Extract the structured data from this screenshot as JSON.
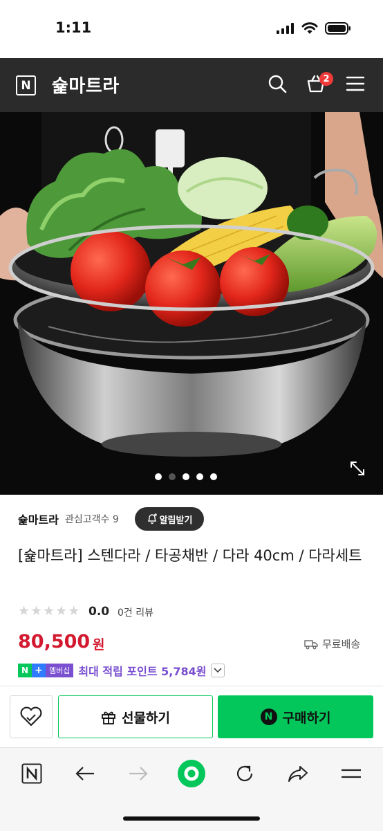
{
  "status_bar": {
    "time": "1:11"
  },
  "header": {
    "logo_letter": "N",
    "store_name": "슕마트라",
    "cart_count": "2",
    "icons": [
      "search-icon",
      "cart-icon",
      "menu-icon"
    ]
  },
  "gallery": {
    "image_count": 5,
    "active_index": 1,
    "icons": [
      "expand-icon"
    ]
  },
  "seller": {
    "name": "슕마트라",
    "fans": "관심고객수 9",
    "notify_label": "알림받기"
  },
  "product": {
    "title": "[슕마트라] 스텐다라 / 타공채반 / 다라 40cm / 다라세트",
    "rating": "0.0",
    "review_count": "0건 리뷰",
    "price": "80,500",
    "price_unit": "원",
    "shipping": "무료배송"
  },
  "membership": {
    "n_badge": "N",
    "plus_badge": "+",
    "member_label": "멤버십",
    "points_text": "최대 적립 포인트 5,784원"
  },
  "actions": {
    "gift_label": "선물하기",
    "buy_label": "구매하기",
    "buy_badge": "N"
  },
  "colors": {
    "naver_green": "#03c75a",
    "price_red": "#d3192f",
    "membership_purple": "#7a4fd0",
    "header_bg": "#2b2b2b"
  }
}
